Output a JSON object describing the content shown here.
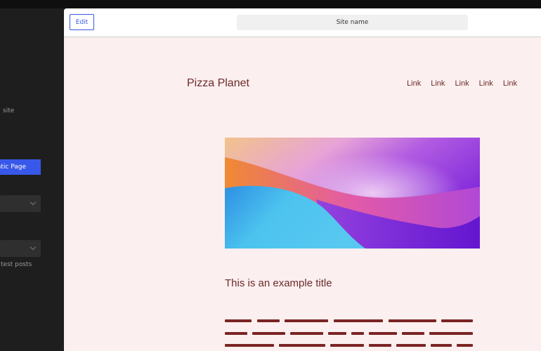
{
  "sidebar": {
    "site_fragment": "site",
    "static_page_btn": "atic Page",
    "latest_posts_fragment": "test posts"
  },
  "toolbar": {
    "edit_label": "Edit",
    "site_name": "Site name"
  },
  "site": {
    "brand": "Pizza Planet",
    "nav": [
      "Link",
      "Link",
      "Link",
      "Link",
      "Link"
    ],
    "post_title": "This is an example title"
  },
  "colors": {
    "accent": "#3858e9",
    "text_brown": "#6b2a2a",
    "page_bg": "#fcefef"
  }
}
